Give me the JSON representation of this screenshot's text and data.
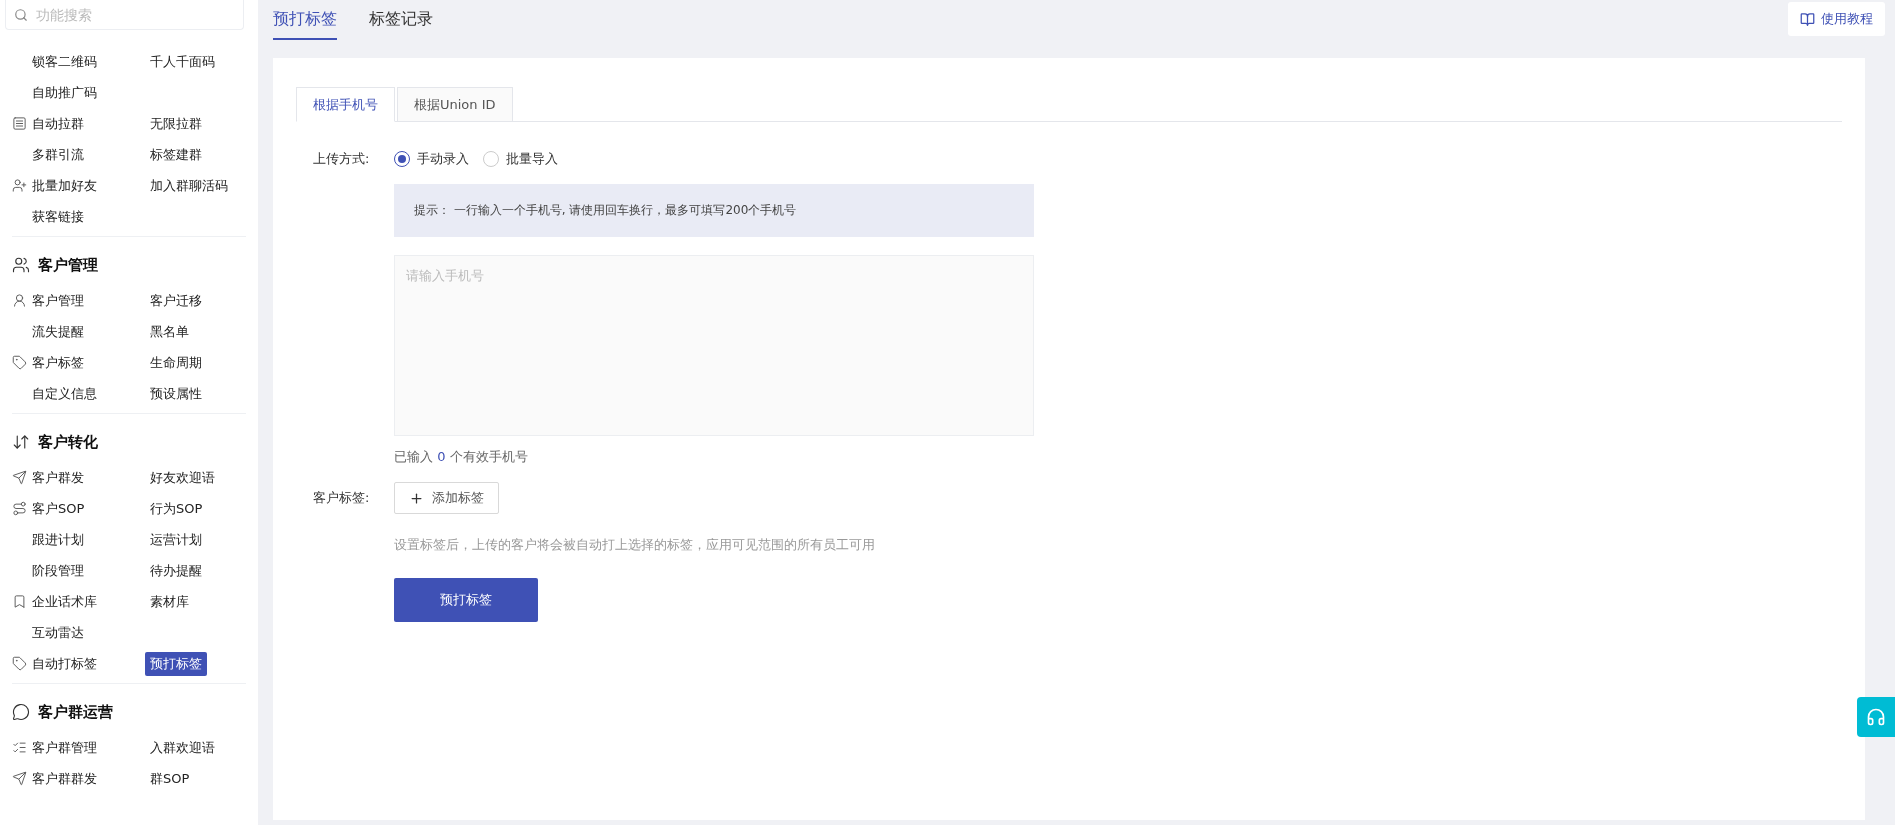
{
  "sidebar": {
    "search": {
      "placeholder": "功能搜索"
    },
    "sections": [
      {
        "rows": [
          [
            {
              "label": "锁客二维码",
              "selected": false
            },
            {
              "label": "千人千面码",
              "selected": false
            }
          ],
          [
            {
              "label": "自助推广码",
              "selected": false
            }
          ],
          [
            {
              "label": "自动拉群",
              "selected": false
            },
            {
              "label": "无限拉群",
              "selected": false
            }
          ],
          [
            {
              "label": "多群引流",
              "selected": false
            },
            {
              "label": "标签建群",
              "selected": false
            }
          ],
          [
            {
              "label": "批量加好友",
              "selected": false
            },
            {
              "label": "加入群聊活码",
              "selected": false
            }
          ],
          [
            {
              "label": "获客链接",
              "selected": false
            }
          ]
        ]
      },
      {
        "title": "客户管理",
        "rows": [
          [
            {
              "label": "客户管理",
              "selected": false
            },
            {
              "label": "客户迁移",
              "selected": false
            }
          ],
          [
            {
              "label": "流失提醒",
              "selected": false
            },
            {
              "label": "黑名单",
              "selected": false
            }
          ],
          [
            {
              "label": "客户标签",
              "selected": false
            },
            {
              "label": "生命周期",
              "selected": false
            }
          ],
          [
            {
              "label": "自定义信息",
              "selected": false
            },
            {
              "label": "预设属性",
              "selected": false
            }
          ]
        ]
      },
      {
        "title": "客户转化",
        "rows": [
          [
            {
              "label": "客户群发",
              "selected": false
            },
            {
              "label": "好友欢迎语",
              "selected": false
            }
          ],
          [
            {
              "label": "客户SOP",
              "selected": false
            },
            {
              "label": "行为SOP",
              "selected": false
            }
          ],
          [
            {
              "label": "跟进计划",
              "selected": false
            },
            {
              "label": "运营计划",
              "selected": false
            }
          ],
          [
            {
              "label": "阶段管理",
              "selected": false
            },
            {
              "label": "待办提醒",
              "selected": false
            }
          ],
          [
            {
              "label": "企业话术库",
              "selected": false
            },
            {
              "label": "素材库",
              "selected": false
            }
          ],
          [
            {
              "label": "互动雷达",
              "selected": false
            }
          ],
          [
            {
              "label": "自动打标签",
              "selected": false
            },
            {
              "label": "预打标签",
              "selected": true
            }
          ]
        ]
      },
      {
        "title": "客户群运营",
        "rows": [
          [
            {
              "label": "客户群管理",
              "selected": false
            },
            {
              "label": "入群欢迎语",
              "selected": false
            }
          ],
          [
            {
              "label": "客户群群发",
              "selected": false
            },
            {
              "label": "群SOP",
              "selected": false
            }
          ]
        ]
      }
    ]
  },
  "top_tabs": [
    {
      "label": "预打标签",
      "selected": true
    },
    {
      "label": "标签记录",
      "selected": false
    }
  ],
  "guide_button": "使用教程",
  "form": {
    "tabs": [
      {
        "label": "根据手机号",
        "selected": true
      },
      {
        "label": "根据Union ID",
        "selected": false
      }
    ],
    "upload_label": "上传方式:",
    "upload_options": [
      {
        "label": "手动录入",
        "selected": true
      },
      {
        "label": "批量导入",
        "selected": false
      }
    ],
    "tip": "提示： 一行输入一个手机号, 请使用回车换行，最多可填写200个手机号",
    "phones": {
      "placeholder": "请输入手机号"
    },
    "count_prefix": "已输入",
    "count": "0",
    "count_suffix": "个有效手机号",
    "tag_label": "客户标签:",
    "add_tag_button": "添加标签",
    "tag_hint": "设置标签后，上传的客户将会被自动打上选择的标签，应用可见范围的所有员工可用",
    "submit_button": "预打标签"
  }
}
